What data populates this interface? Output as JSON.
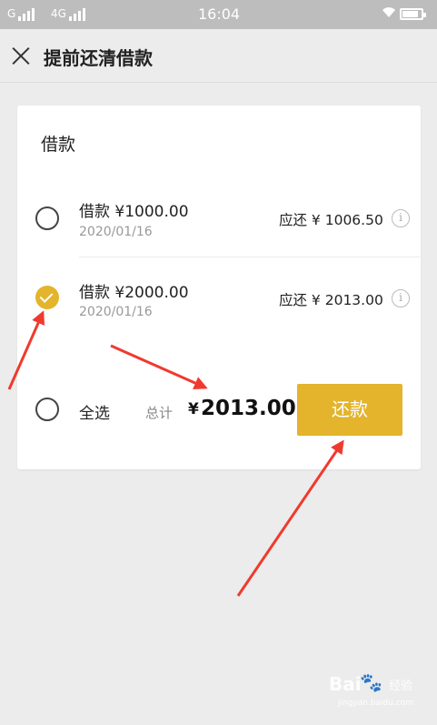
{
  "status_bar": {
    "network1": "G",
    "network2": "4G",
    "time": "16:04",
    "battery_level": 0.85
  },
  "header": {
    "title": "提前还清借款",
    "close_icon": "close-icon"
  },
  "card": {
    "title": "借款",
    "loans": [
      {
        "title": "借款 ¥1000.00",
        "date": "2020/01/16",
        "due": "应还 ¥ 1006.50",
        "checked": false
      },
      {
        "title": "借款 ¥2000.00",
        "date": "2020/01/16",
        "due": "应还 ¥ 2013.00",
        "checked": true
      }
    ],
    "select_all_label": "全选",
    "total_label": "总计",
    "total_currency": "¥",
    "total_amount": "2013.00",
    "repay_button": "还款",
    "accent_color": "#e3b42c"
  },
  "annotations": {
    "arrow_color": "#f03a2e"
  },
  "watermark": {
    "brand": "Bai",
    "brand_sub": "经验",
    "url": "jingyan.baidu.com"
  }
}
